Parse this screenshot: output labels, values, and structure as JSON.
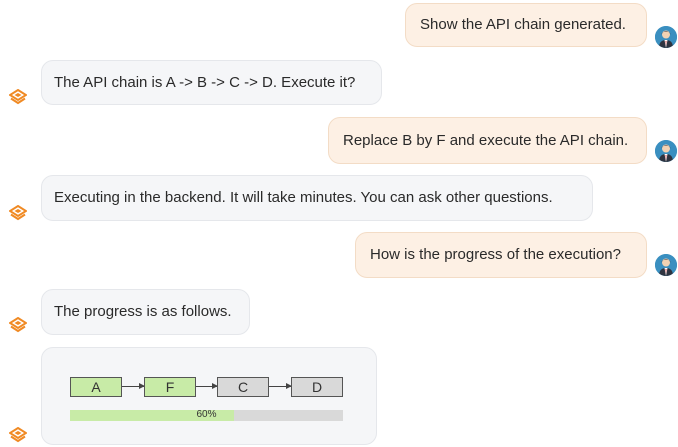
{
  "messages": [
    {
      "role": "user",
      "text": "Show the API chain generated."
    },
    {
      "role": "bot",
      "text": "The API chain is A -> B -> C -> D. Execute it?"
    },
    {
      "role": "user",
      "text": "Replace B by F and execute the API chain."
    },
    {
      "role": "bot",
      "text": "Executing in the backend. It will take minutes. You can ask other questions."
    },
    {
      "role": "user",
      "text": "How is the progress of the execution?"
    },
    {
      "role": "bot",
      "text": "The progress is as follows."
    }
  ],
  "progress_card": {
    "nodes": [
      {
        "label": "A",
        "status": "done"
      },
      {
        "label": "F",
        "status": "done"
      },
      {
        "label": "C",
        "status": "pending"
      },
      {
        "label": "D",
        "status": "pending"
      }
    ],
    "progress_fraction": 0.6,
    "progress_label": "60%"
  },
  "colors": {
    "user_bubble": "#fdf0e4",
    "bot_bubble": "#f5f6f8",
    "bot_icon": "#f08a24",
    "done": "#c8eba7",
    "pending": "#d9d9d9"
  },
  "icons": {
    "user_avatar": "user-avatar-icon",
    "bot_avatar": "assistant-logo-icon"
  }
}
